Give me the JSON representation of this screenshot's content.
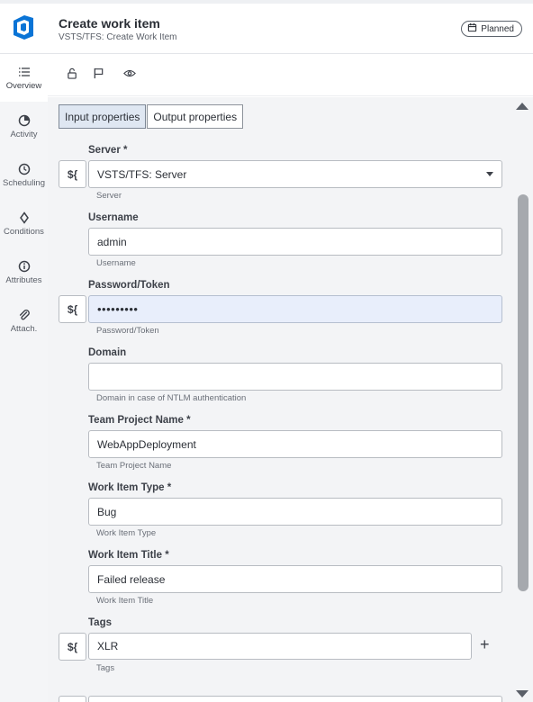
{
  "header": {
    "title": "Create work item",
    "subtitle": "VSTS/TFS: Create Work Item",
    "status_badge": "Planned",
    "logo_icon": "azure-devops-logo",
    "badge_icon": "calendar-icon"
  },
  "sidebar": {
    "items": [
      {
        "label": "Overview",
        "icon": "list-icon",
        "active": true
      },
      {
        "label": "Activity",
        "icon": "pie-icon",
        "active": false
      },
      {
        "label": "Scheduling",
        "icon": "clock-icon",
        "active": false
      },
      {
        "label": "Conditions",
        "icon": "diamond-icon",
        "active": false
      },
      {
        "label": "Attributes",
        "icon": "info-icon",
        "active": false
      },
      {
        "label": "Attach.",
        "icon": "paperclip-icon",
        "active": false
      }
    ]
  },
  "toolbar": {
    "icons": [
      "unlock-icon",
      "flag-icon",
      "eye-icon"
    ]
  },
  "tabs": {
    "input": "Input properties",
    "output": "Output properties"
  },
  "variable_button_label": "${",
  "form": {
    "server": {
      "label": "Server *",
      "value": "VSTS/TFS: Server",
      "help": "Server"
    },
    "username": {
      "label": "Username",
      "value": "admin",
      "help": "Username"
    },
    "password": {
      "label": "Password/Token",
      "value": "•••••••••",
      "help": "Password/Token"
    },
    "domain": {
      "label": "Domain",
      "value": "",
      "help": "Domain in case of NTLM authentication"
    },
    "team_project": {
      "label": "Team Project Name *",
      "value": "WebAppDeployment",
      "help": "Team Project Name"
    },
    "work_item_type": {
      "label": "Work Item Type *",
      "value": "Bug",
      "help": "Work Item Type"
    },
    "work_item_title": {
      "label": "Work Item Title *",
      "value": "Failed release",
      "help": "Work Item Title"
    },
    "tags": {
      "label": "Tags",
      "value": "XLR",
      "help": "Tags",
      "add_label": "+"
    }
  },
  "colors": {
    "accent": "#0078d4",
    "selected_tab": "#dfe7f2",
    "filled_field": "#e8eefb"
  }
}
